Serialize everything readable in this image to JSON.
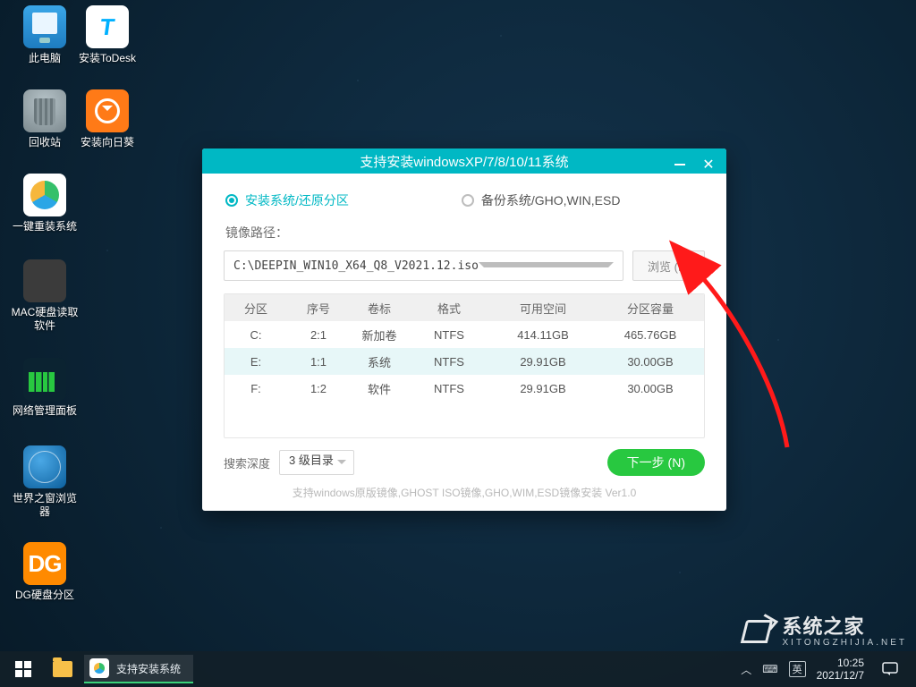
{
  "desktop": {
    "icons": [
      {
        "name": "此电脑",
        "icon": "monitor"
      },
      {
        "name": "安装ToDesk",
        "icon": "todesk"
      },
      {
        "name": "回收站",
        "icon": "bin"
      },
      {
        "name": "安装向日葵",
        "icon": "sun"
      },
      {
        "name": "一键重装系统",
        "icon": "reinstall"
      },
      {
        "name": "MAC硬盘读取软件",
        "icon": "mac"
      },
      {
        "name": "网络管理面板",
        "icon": "netpanel"
      },
      {
        "name": "世界之窗浏览器",
        "icon": "globe"
      },
      {
        "name": "DG硬盘分区",
        "icon": "dg"
      }
    ]
  },
  "installer": {
    "title": "支持安装windowsXP/7/8/10/11系统",
    "mode_install": "安装系统/还原分区",
    "mode_backup": "备份系统/GHO,WIN,ESD",
    "path_label": "镜像路径：",
    "path_value": "C:\\DEEPIN_WIN10_X64_Q8_V2021.12.iso",
    "browse": "浏览 (B)",
    "columns": [
      "分区",
      "序号",
      "卷标",
      "格式",
      "可用空间",
      "分区容量"
    ],
    "rows": [
      {
        "part": "C:",
        "no": "2:1",
        "label": "新加卷",
        "fs": "NTFS",
        "free": "414.11GB",
        "size": "465.76GB",
        "selected": false
      },
      {
        "part": "E:",
        "no": "1:1",
        "label": "系统",
        "fs": "NTFS",
        "free": "29.91GB",
        "size": "30.00GB",
        "selected": true
      },
      {
        "part": "F:",
        "no": "1:2",
        "label": "软件",
        "fs": "NTFS",
        "free": "29.91GB",
        "size": "30.00GB",
        "selected": false
      }
    ],
    "depth_label": "搜索深度",
    "depth_value": "3 级目录",
    "next": "下一步 (N)",
    "hint": "支持windows原版镜像,GHOST ISO镜像,GHO,WIM,ESD镜像安装 Ver1.0"
  },
  "taskbar": {
    "active_app": "支持安装系统",
    "time": "10:25",
    "date": "2021/12/7"
  },
  "watermark": {
    "cn": "系统之家",
    "en": "XITONGZHIJIA.NET"
  },
  "colors": {
    "brand_teal": "#00b8c4",
    "brand_green": "#28c840",
    "arrow": "#ff1a1a"
  }
}
